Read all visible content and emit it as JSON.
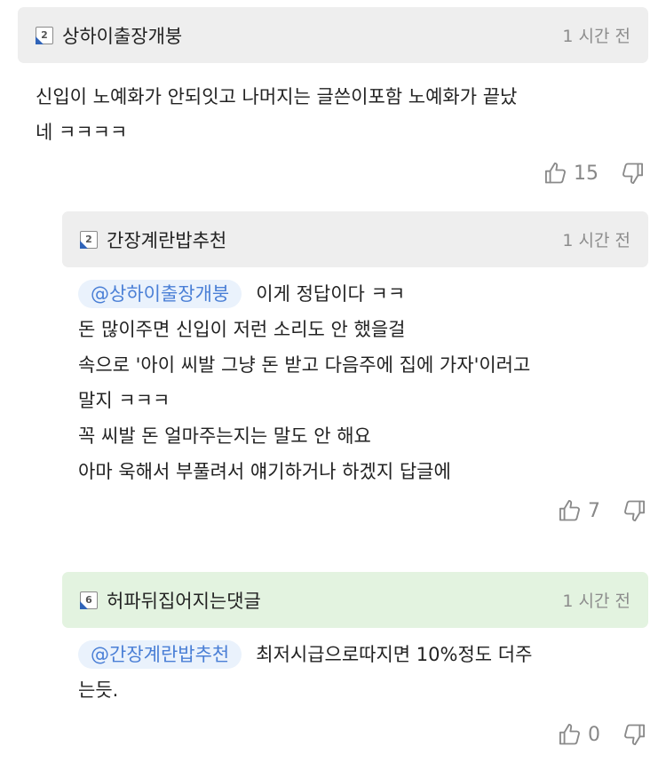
{
  "comments": [
    {
      "level": "2",
      "author": "상하이출장개붕",
      "time": "1 시간 전",
      "mention": "",
      "lines": [
        "신입이 노예화가 안되잇고 나머지는 글쓴이포함 노예화가 끝났",
        "네 ㅋㅋㅋㅋ"
      ],
      "likes": "15",
      "header_color": "#eeeeee"
    },
    {
      "level": "2",
      "author": "간장계란밥추천",
      "time": "1 시간 전",
      "mention": "@상하이출장개붕",
      "lines": [
        "이게 정답이다 ㅋㅋ",
        "돈 많이주면 신입이 저런 소리도 안 했을걸",
        "속으로 '아이 씨발 그냥 돈 받고 다음주에 집에 가자'이러고",
        "말지 ㅋㅋㅋ",
        "꼭 씨발 돈 얼마주는지는 말도 안 해요",
        "아마 욱해서 부풀려서 얘기하거나 하겠지 답글에"
      ],
      "likes": "7",
      "header_color": "#eeeeee"
    },
    {
      "level": "6",
      "author": "허파뒤집어지는댓글",
      "time": "1 시간 전",
      "mention": "@간장계란밥추천",
      "lines": [
        "최저시급으로따지면 10%정도 더주",
        "는듯."
      ],
      "likes": "0",
      "header_color": "#e3f3e0"
    }
  ],
  "icons": {
    "level": "level-badge-icon",
    "like": "thumbs-up-icon",
    "dislike": "thumbs-down-icon"
  }
}
